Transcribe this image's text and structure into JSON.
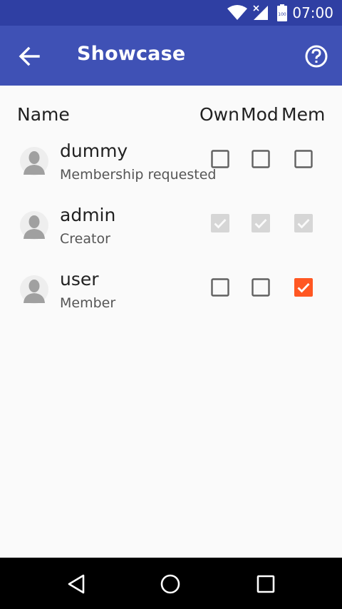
{
  "status_bar": {
    "time": "07:00",
    "battery": "100"
  },
  "app_bar": {
    "title": "Showcase"
  },
  "columns": {
    "name": "Name",
    "own": "Own",
    "mod": "Mod",
    "mem": "Mem"
  },
  "members": [
    {
      "name": "dummy",
      "role": "Membership requested",
      "own": "unchecked",
      "mod": "unchecked",
      "mem": "unchecked"
    },
    {
      "name": "admin",
      "role": "Creator",
      "own": "checked-disabled",
      "mod": "checked-disabled",
      "mem": "checked-disabled"
    },
    {
      "name": "user",
      "role": "Member",
      "own": "unchecked",
      "mod": "unchecked",
      "mem": "checked"
    }
  ],
  "colors": {
    "status_bar": "#2f3fa3",
    "app_bar": "#3f51b5",
    "accent": "#ff5722",
    "disabled": "#d6d6d6"
  }
}
